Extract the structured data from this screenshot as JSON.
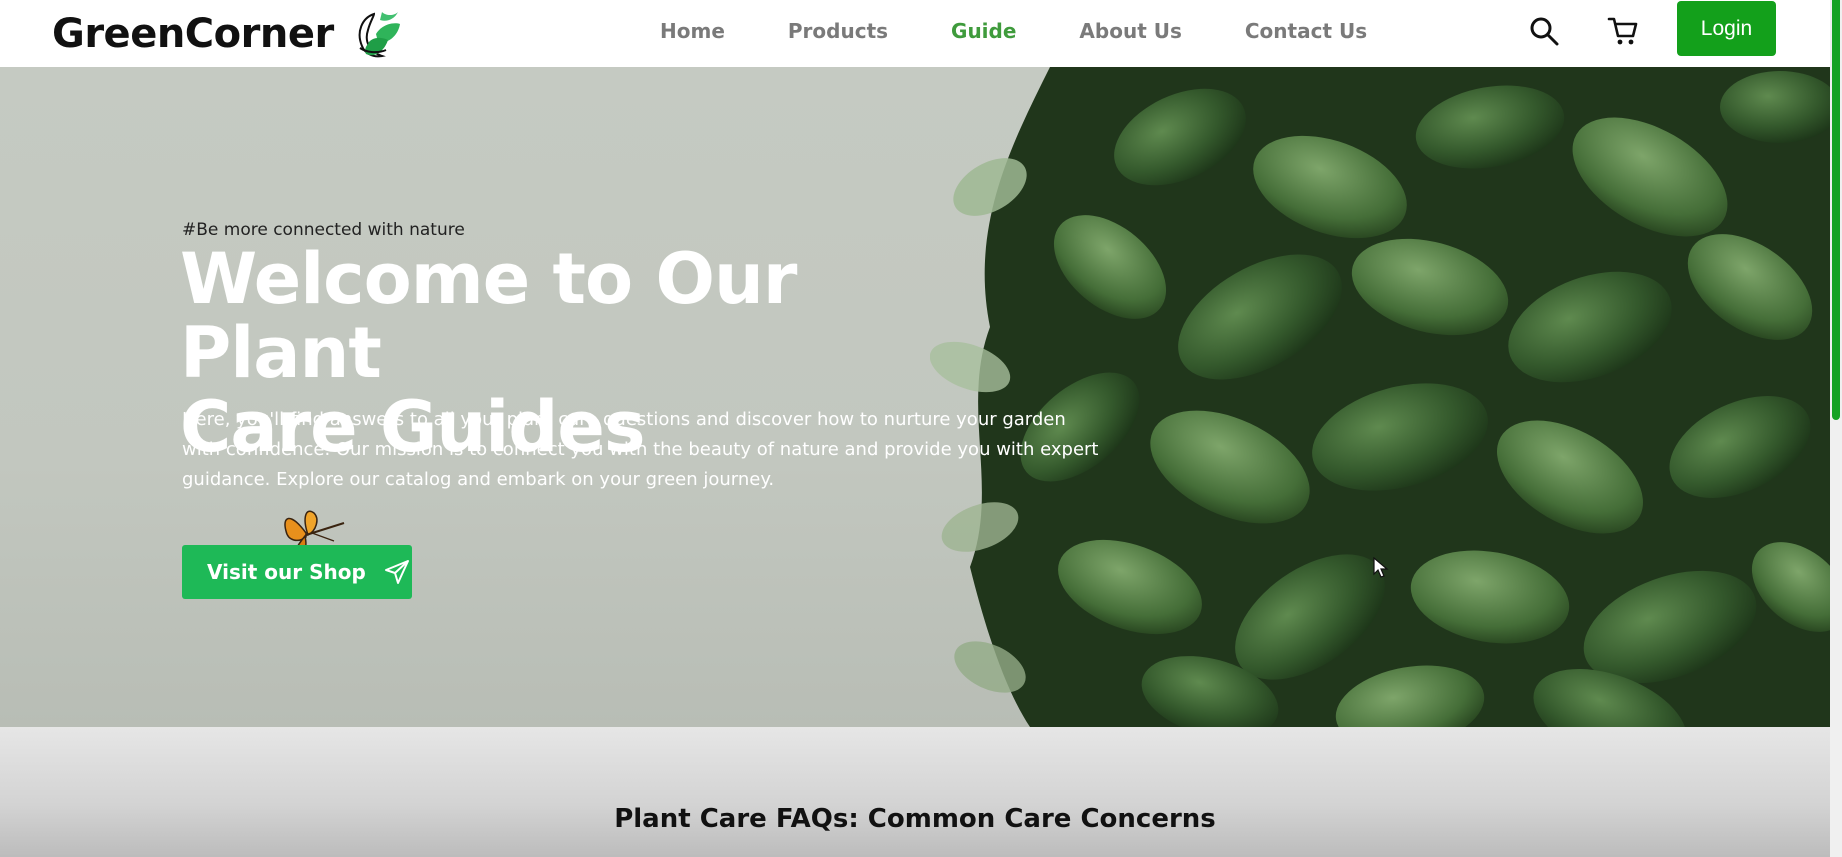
{
  "header": {
    "brand": "GreenCorner",
    "logo_icon": "leaves-icon",
    "nav": [
      {
        "label": "Home",
        "active": false
      },
      {
        "label": "Products",
        "active": false
      },
      {
        "label": "Guide",
        "active": true
      },
      {
        "label": "About Us",
        "active": false
      },
      {
        "label": "Contact Us",
        "active": false
      }
    ],
    "search_icon": "search-icon",
    "cart_icon": "cart-icon",
    "login_label": "Login"
  },
  "hero": {
    "tagline": "#Be more connected with nature",
    "title_line1": "Welcome to Our Plant",
    "title_line2": "Care Guides",
    "description": "Here, you'll find answers to all your plant care questions and discover how to nurture your garden with confidence. Our mission is to connect you with the beauty of nature and provide you with expert guidance. Explore our catalog and embark on your green journey.",
    "cta_label": "Visit our Shop",
    "cta_icon": "send-icon",
    "decoration_icon": "butterfly-icon"
  },
  "faq": {
    "title": "Plant Care FAQs: Common Care Concerns"
  },
  "colors": {
    "brand_green": "#13a01b",
    "cta_green": "#1eb957",
    "active_nav": "#3f9b3c",
    "hero_bg": "#c5cac2"
  }
}
